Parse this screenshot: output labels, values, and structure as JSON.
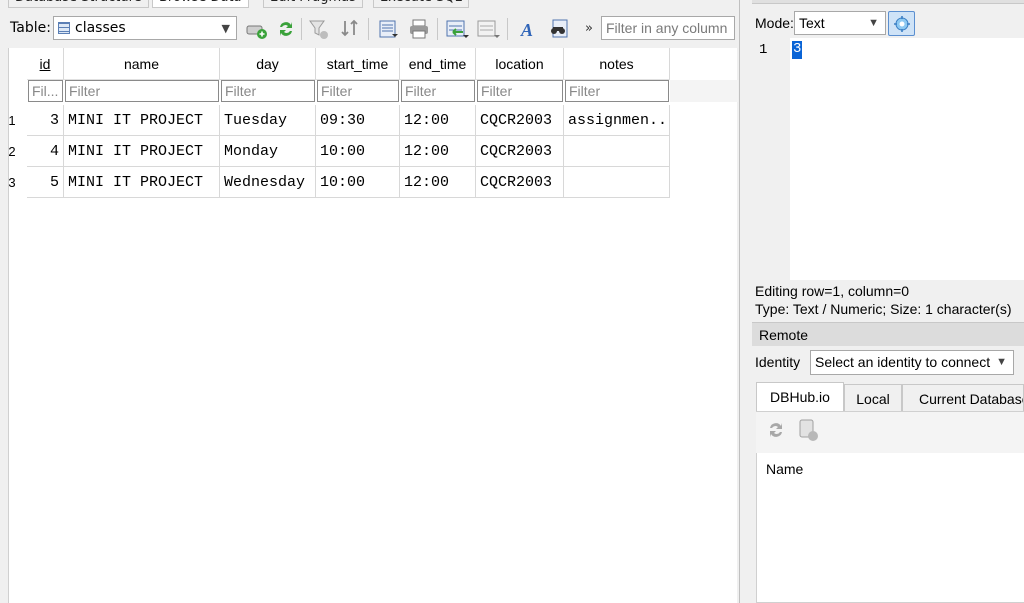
{
  "tabs": [
    "Database Structure",
    "Browse Data",
    "Edit Pragmas",
    "Execute SQL"
  ],
  "toolbar": {
    "table_label": "Table:",
    "table_value": "classes",
    "overflow_chevron": "»",
    "filter_placeholder": "Filter in any column"
  },
  "grid": {
    "columns": [
      "id",
      "name",
      "day",
      "start_time",
      "end_time",
      "location",
      "notes"
    ],
    "filter_placeholders": [
      "Fil...",
      "Filter",
      "Filter",
      "Filter",
      "Filter",
      "Filter",
      "Filter"
    ],
    "rows": [
      {
        "row_no": "1",
        "id": "3",
        "name": "MINI IT PROJECT",
        "day": "Tuesday",
        "start_time": "09:30",
        "end_time": "12:00",
        "location": "CQCR2003",
        "notes": "assignmen..."
      },
      {
        "row_no": "2",
        "id": "4",
        "name": "MINI IT PROJECT",
        "day": "Monday",
        "start_time": "10:00",
        "end_time": "12:00",
        "location": "CQCR2003",
        "notes": ""
      },
      {
        "row_no": "3",
        "id": "5",
        "name": "MINI IT PROJECT",
        "day": "Wednesday",
        "start_time": "10:00",
        "end_time": "12:00",
        "location": "CQCR2003",
        "notes": ""
      }
    ]
  },
  "edit_cell": {
    "mode_label": "Mode:",
    "mode_value": "Text",
    "line_number": "1",
    "value": "3",
    "status_line1": "Editing row=1, column=0",
    "status_line2": "Type: Text / Numeric; Size: 1 character(s)"
  },
  "remote": {
    "header": "Remote",
    "identity_label": "Identity",
    "identity_value": "Select an identity to connect",
    "tabs": [
      "DBHub.io",
      "Local",
      "Current Database"
    ],
    "column_header": "Name"
  },
  "icons": [
    "table-icon",
    "add-record-icon",
    "refresh-icon",
    "clear-filters-icon",
    "sort-icon",
    "save-table-icon",
    "print-icon",
    "insert-values-icon",
    "delete-values-icon",
    "font-icon",
    "find-icon",
    "auto-mode-icon",
    "remote-refresh-icon",
    "remote-db-icon"
  ]
}
